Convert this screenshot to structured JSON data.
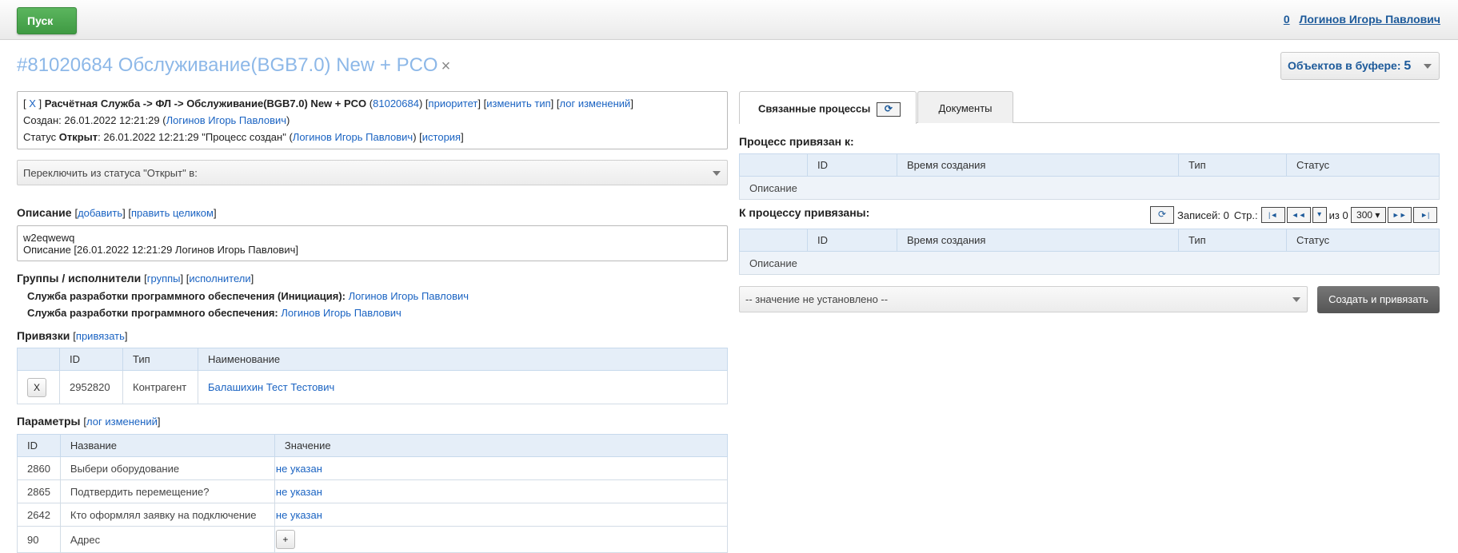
{
  "topbar": {
    "start": "Пуск",
    "count": "0",
    "user": "Логинов Игорь Павлович"
  },
  "title": {
    "text": "#81020684 Обслуживание(BGB7.0) New + PCO",
    "close": "×"
  },
  "buffer": {
    "label": "Объектов в буфере:",
    "count": "5"
  },
  "info": {
    "line1": {
      "open": "[",
      "x": "X",
      "close": "]",
      "path": "Расчётная Служба -> ФЛ -> Обслуживание(BGB7.0) New + PCO",
      "id_open": "(",
      "id": "81020684",
      "id_close": ")",
      "priority": "приоритет",
      "change_type": "изменить тип",
      "log": "лог изменений"
    },
    "line2": {
      "label": "Создан: 26.01.2022 12:21:29 (",
      "user": "Логинов Игорь Павлович",
      "close": ")"
    },
    "line3": {
      "label": "Статус",
      "status": "Открыт",
      "rest": ": 26.01.2022 12:21:29 \"Процесс создан\" (",
      "user": "Логинов Игорь Павлович",
      "mid": ") [",
      "history": "история",
      "close": "]"
    }
  },
  "switch_status": {
    "placeholder": "Переключить из статуса \"Открыт\" в:"
  },
  "description": {
    "heading": "Описание",
    "add": "добавить",
    "edit": "править целиком",
    "text1": "w2eqwewq",
    "text2": "Описание [26.01.2022 12:21:29 Логинов Игорь Павлович]"
  },
  "groups": {
    "heading": "Группы / исполнители",
    "groups_link": "группы",
    "executors_link": "исполнители",
    "items": [
      {
        "label": "Служба разработки программного обеспечения (Инициация):",
        "user": "Логинов Игорь Павлович"
      },
      {
        "label": "Служба разработки программного обеспечения:",
        "user": "Логинов Игорь Павлович"
      }
    ]
  },
  "links": {
    "heading": "Привязки",
    "bind": "привязать",
    "columns": [
      "",
      "ID",
      "Тип",
      "Наименование"
    ],
    "rows": [
      {
        "x": "X",
        "id": "2952820",
        "type": "Контрагент",
        "name": "Балашихин Тест Тестович"
      }
    ]
  },
  "params": {
    "heading": "Параметры",
    "log": "лог изменений",
    "columns": [
      "ID",
      "Название",
      "Значение"
    ],
    "rows": [
      {
        "id": "2860",
        "name": "Выбери оборудование",
        "value": "не указан"
      },
      {
        "id": "2865",
        "name": "Подтвердить перемещение?",
        "value": "не указан"
      },
      {
        "id": "2642",
        "name": "Кто оформлял заявку на подключение",
        "value": "не указан"
      },
      {
        "id": "90",
        "name": "Адрес",
        "value": "+"
      }
    ]
  },
  "tabs": {
    "related": "Связанные процессы",
    "documents": "Документы",
    "refresh": "⟳"
  },
  "linked_to": {
    "heading": "Процесс привязан к:",
    "columns": [
      "",
      "ID",
      "Время создания",
      "Тип",
      "Статус"
    ],
    "desc": "Описание"
  },
  "linked_from": {
    "heading": "К процессу привязаны:",
    "columns": [
      "",
      "ID",
      "Время создания",
      "Тип",
      "Статус"
    ],
    "desc": "Описание"
  },
  "pager": {
    "records": "Записей: 0",
    "page": "Стр.:",
    "of": "из 0",
    "size": "300",
    "first": "|◄",
    "prev": "◄◄",
    "next": "►►",
    "last": "►|"
  },
  "create": {
    "select": "-- значение не установлено --",
    "button": "Создать и привязать"
  }
}
